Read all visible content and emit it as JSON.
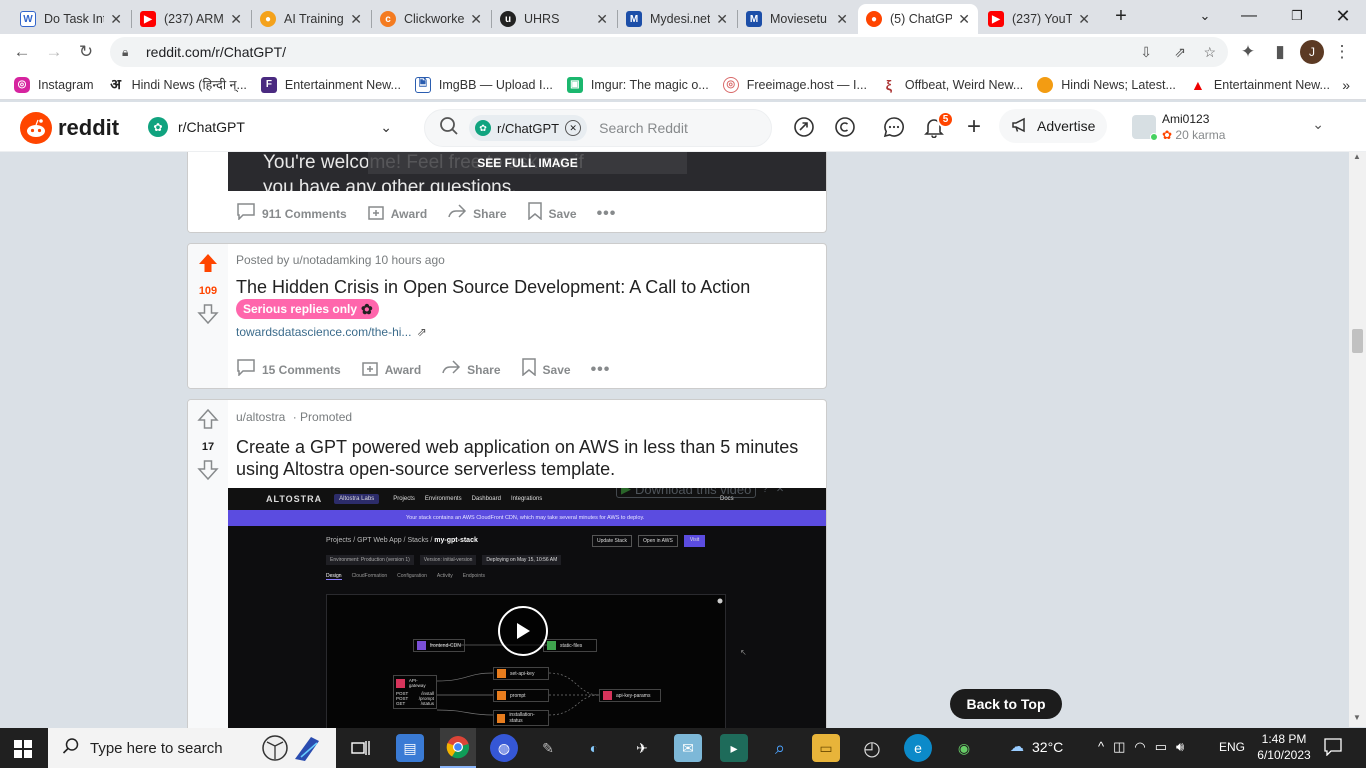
{
  "browser": {
    "tabs": [
      {
        "title": "Do Task Int",
        "icon": "wikipedia-w-icon",
        "color": "#3366cc"
      },
      {
        "title": "(237) ARM",
        "icon": "youtube-icon",
        "color": "#ff0000"
      },
      {
        "title": "AI Training",
        "icon": "ai-training-icon",
        "color": "#f4a21c"
      },
      {
        "title": "Clickworke",
        "icon": "clickworker-icon",
        "color": "#f47b20"
      },
      {
        "title": "UHRS",
        "icon": "uhrs-icon",
        "color": "#222222"
      },
      {
        "title": "Mydesi.net",
        "icon": "mydesi-m-icon",
        "color": "#1c4ea8"
      },
      {
        "title": "Moviesetu",
        "icon": "moviesetu-m-icon",
        "color": "#1c4ea8"
      },
      {
        "title": "(5) ChatGP",
        "icon": "reddit-icon",
        "color": "#ff4500"
      },
      {
        "title": "(237) YouT",
        "icon": "youtube-icon",
        "color": "#ff0000"
      }
    ],
    "url": "reddit.com/r/ChatGPT/",
    "profile_initial": "J",
    "bookmarks": [
      {
        "label": "Instagram",
        "color": "#d6249f"
      },
      {
        "label": "Hindi News (हिन्दी न्...",
        "color": "#222222"
      },
      {
        "label": "Entertainment New...",
        "color": "#4a2a80"
      },
      {
        "label": "ImgBB — Upload I...",
        "color": "#2a5db0"
      },
      {
        "label": "Imgur: The magic o...",
        "color": "#1bb76e"
      },
      {
        "label": "Freeimage.host — I...",
        "color": "#d96a6a"
      },
      {
        "label": "Offbeat, Weird New...",
        "color": "#a33"
      },
      {
        "label": "Hindi News; Latest...",
        "color": "#f39c12"
      },
      {
        "label": "Entertainment New...",
        "color": "#e00"
      }
    ],
    "more_bookmarks": "»"
  },
  "reddit_header": {
    "logo_text": "reddit",
    "community": "r/ChatGPT",
    "search_chip": "r/ChatGPT",
    "search_placeholder": "Search Reddit",
    "notification_count": "5",
    "advertise_label": "Advertise",
    "username": "Ami0123",
    "karma": "20 karma"
  },
  "feed": {
    "previous_post": {
      "image_text_line1": "You're welcome! Feel free to ask me if",
      "image_text_line2": "you have any other questions.",
      "see_full_image": "SEE FULL IMAGE",
      "comments": "911 Comments",
      "award": "Award",
      "share": "Share",
      "save": "Save"
    },
    "post": {
      "posted_by": "Posted by u/notadamking",
      "time": "10 hours ago",
      "votes": "109",
      "title": "The Hidden Crisis in Open Source Development: A Call to Action",
      "flair": "Serious replies only",
      "link": "towardsdatascience.com/the-hi...",
      "comments": "15 Comments",
      "award": "Award",
      "share": "Share",
      "save": "Save"
    },
    "promoted": {
      "author": "u/altostra",
      "label": "· Promoted",
      "votes": "17",
      "title_line1": "Create a GPT powered web application on AWS in less than 5 minutes",
      "title_line2": "using Altostra open-source serverless template.",
      "video": {
        "brand": "ALTOSTRA",
        "org": "Altostra Labs",
        "nav": [
          "Projects",
          "Environments",
          "Dashboard",
          "Integrations"
        ],
        "docs": "Docs",
        "banner": "Your stack contains an AWS CloudFront CDN, which may take several minutes for AWS to deploy.",
        "breadcrumb": "Projects / GPT Web App / Stacks /",
        "stack_name": "my-gpt-stack",
        "buttons": [
          "Update Stack",
          "Open in AWS",
          "Visit"
        ],
        "env_text": "Environment: Production (version 1)",
        "version_text": "Version: initial-version",
        "deploy_text": "Deploying on May 15, 10:56 AM",
        "tabs": [
          "Design",
          "CloudFormation",
          "Configuration",
          "Activity",
          "Endpoints"
        ],
        "nodes": {
          "cdn": "frontend-CDN",
          "static": "static-files",
          "api": "API-gateway",
          "set_key": "set-api-key",
          "prompt": "prompt",
          "install": "installation-status",
          "params": "api-key-params"
        },
        "routes": [
          {
            "method": "POST",
            "path": "/install"
          },
          {
            "method": "POST",
            "path": "/prompt"
          },
          {
            "method": "GET",
            "path": "/status"
          }
        ],
        "download_overlay": "Download this video"
      }
    }
  },
  "back_to_top": "Back to Top",
  "taskbar": {
    "search_placeholder": "Type here to search",
    "weather": "32°C",
    "language": "ENG",
    "time": "1:48 PM",
    "date": "6/10/2023"
  }
}
